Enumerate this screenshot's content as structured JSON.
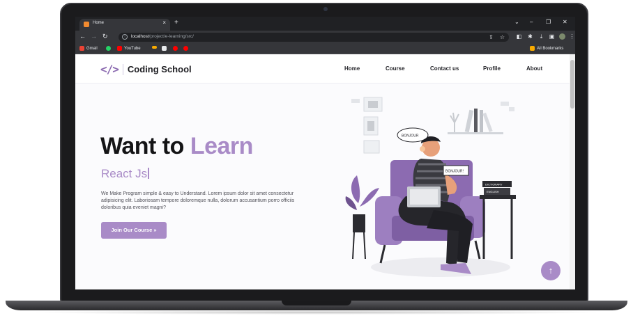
{
  "browser": {
    "tab_title": "Home",
    "tab_close": "×",
    "new_tab": "+",
    "url_host": "localhost",
    "url_path": "/project/e-learning/src/",
    "window_controls": [
      "⌄",
      "–",
      "❐",
      "✕"
    ],
    "bookmarks": [
      {
        "label": "Gmail",
        "color": "#ea4335"
      },
      {
        "label": "",
        "color": "#25d366"
      },
      {
        "label": "YouTube",
        "color": "#ff0000"
      },
      {
        "label": "",
        "color": "#f9ab00"
      },
      {
        "label": "",
        "color": "#e8eaed"
      },
      {
        "label": "",
        "color": "#ff0000"
      },
      {
        "label": "",
        "color": "#ff0000"
      }
    ],
    "all_bookmarks": "All Bookmarks"
  },
  "site": {
    "logo_mark": "</>",
    "logo_text": "Coding School",
    "nav": [
      "Home",
      "Course",
      "Contact us",
      "Profile",
      "About"
    ]
  },
  "hero": {
    "title_plain": "Want to ",
    "title_accent": "Learn",
    "typed_text": "React Js",
    "description": "We Make Program simple & easy to Understand. Lorem ipsum dolor sit amet consectetur adipisicing elit. Laboriosam tempore doloremque nulla, dolorum accusantium porro officiis doloribus quia eveniet magni?",
    "cta_label": "Join Our Course  »"
  },
  "illustration": {
    "bubble_1": "BONJOUR",
    "bubble_2": "BONJOUR!",
    "book_1": "DICTIONARY",
    "book_2": "ENGLISH"
  },
  "scroll_top_icon": "↑",
  "colors": {
    "accent": "#a98bc7",
    "browser_dark": "#202124",
    "browser_mid": "#35363a"
  }
}
